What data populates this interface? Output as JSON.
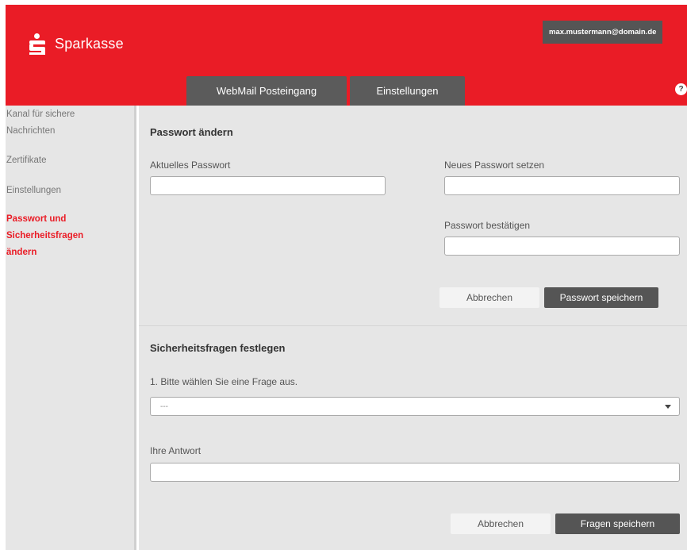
{
  "header": {
    "brand": "Sparkasse",
    "user_email": "max.mustermann@domain.de",
    "tabs": [
      {
        "label": "WebMail Posteingang"
      },
      {
        "label": "Einstellungen"
      }
    ],
    "help_label": "?"
  },
  "sidebar": {
    "items": [
      {
        "label": "Kanal für sichere Nachrichten"
      },
      {
        "label": "Zertifikate"
      },
      {
        "label": "Einstellungen"
      },
      {
        "label": "Passwort und Sicherheitsfragen ändern"
      }
    ]
  },
  "password": {
    "title": "Passwort ändern",
    "current_label": "Aktuelles Passwort",
    "new_label": "Neues Passwort setzen",
    "confirm_label": "Passwort bestätigen",
    "cancel_label": "Abbrechen",
    "save_label": "Passwort speichern"
  },
  "security": {
    "title": "Sicherheitsfragen festlegen",
    "question_label": "1. Bitte wählen Sie eine Frage aus.",
    "question_value": "---",
    "answer_label": "Ihre Antwort",
    "cancel_label": "Abbrechen",
    "save_label": "Fragen speichern"
  },
  "colors": {
    "brand_red": "#ea1c26",
    "dark_button": "#555555",
    "panel_grey": "#e6e6e6"
  }
}
